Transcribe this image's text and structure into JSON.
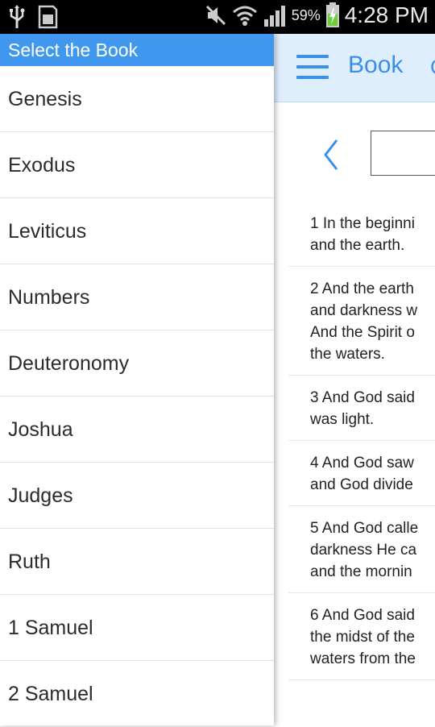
{
  "status_bar": {
    "battery_percent": "59%",
    "time": "4:28 PM",
    "icons": [
      "usb-icon",
      "sd-card-icon",
      "mute-icon",
      "wifi-icon",
      "signal-icon",
      "battery-charging-icon"
    ]
  },
  "drawer": {
    "header": "Select the Book",
    "books": [
      "Genesis",
      "Exodus",
      "Leviticus",
      "Numbers",
      "Deuteronomy",
      "Joshua",
      "Judges",
      "Ruth",
      "1 Samuel",
      "2 Samuel"
    ]
  },
  "app_bar": {
    "title": "Book",
    "extra": "C"
  },
  "verses": [
    [
      "1 In the beginni",
      "and the earth."
    ],
    [
      "2 And the earth",
      "and darkness w",
      "And the Spirit o",
      "the waters."
    ],
    [
      "3 And God said",
      "was light."
    ],
    [
      "4 And God saw",
      "and God divide"
    ],
    [
      "5 And God calle",
      "darkness He ca",
      "and the mornin"
    ],
    [
      "6 And God said",
      "the midst of the",
      "waters from the"
    ]
  ],
  "colors": {
    "accent": "#3a8fe8",
    "drawer_header": "#3f98ee",
    "app_bar_bg": "#dfeefd"
  }
}
